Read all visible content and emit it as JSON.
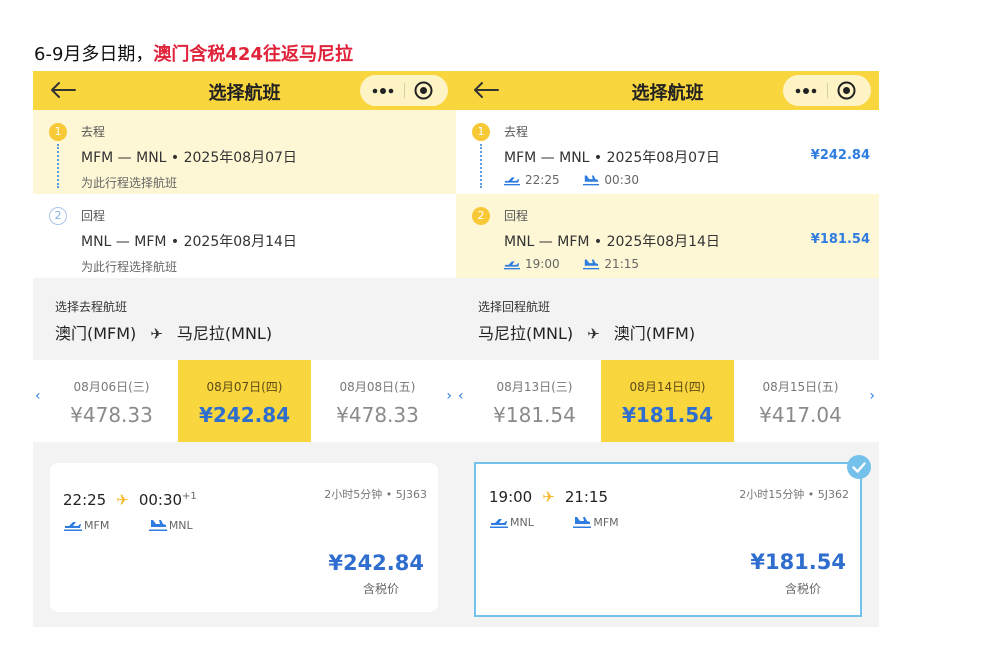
{
  "headline": {
    "prefix": "6-9月多日期，",
    "highlight": "澳门含税424往返马尼拉"
  },
  "colors": {
    "accent_yellow": "#f9d53e",
    "price_blue": "#2f6ecf",
    "headline_red": "#e0233a",
    "selected_border": "#74c2ec"
  },
  "panels": [
    {
      "nav_title": "选择航班",
      "legs": [
        {
          "num": "1",
          "type": "去程",
          "route": "MFM — MNL • 2025年08月07日",
          "hint": "为此行程选择航班"
        },
        {
          "num": "2",
          "type": "回程",
          "route": "MNL — MFM • 2025年08月14日",
          "hint": "为此行程选择航班"
        }
      ],
      "route_label": "选择去程航班",
      "from_city": "澳门(MFM)",
      "to_city": "马尼拉(MNL)",
      "dates": [
        {
          "label": "08月06日(三)",
          "price": "¥478.33"
        },
        {
          "label": "08月07日(四)",
          "price": "¥242.84",
          "selected": true
        },
        {
          "label": "08月08日(五)",
          "price": "¥478.33"
        }
      ],
      "flight": {
        "dep": "22:25",
        "arr": "00:30",
        "day_offset": "+1",
        "duration": "2小时5分钟",
        "code": "5J363",
        "dep_airport": "MFM",
        "arr_airport": "MNL",
        "price": "¥242.84",
        "tax_note": "含税价"
      }
    },
    {
      "nav_title": "选择航班",
      "legs": [
        {
          "num": "1",
          "type": "去程",
          "route": "MFM — MNL • 2025年08月07日",
          "price": "¥242.84",
          "dep": "22:25",
          "arr": "00:30"
        },
        {
          "num": "2",
          "type": "回程",
          "route": "MNL — MFM • 2025年08月14日",
          "price": "¥181.54",
          "dep": "19:00",
          "arr": "21:15"
        }
      ],
      "route_label": "选择回程航班",
      "from_city": "马尼拉(MNL)",
      "to_city": "澳门(MFM)",
      "dates": [
        {
          "label": "08月13日(三)",
          "price": "¥181.54"
        },
        {
          "label": "08月14日(四)",
          "price": "¥181.54",
          "selected": true
        },
        {
          "label": "08月15日(五)",
          "price": "¥417.04"
        }
      ],
      "flight": {
        "dep": "19:00",
        "arr": "21:15",
        "duration": "2小时15分钟",
        "code": "5J362",
        "dep_airport": "MNL",
        "arr_airport": "MFM",
        "price": "¥181.54",
        "tax_note": "含税价"
      }
    }
  ]
}
